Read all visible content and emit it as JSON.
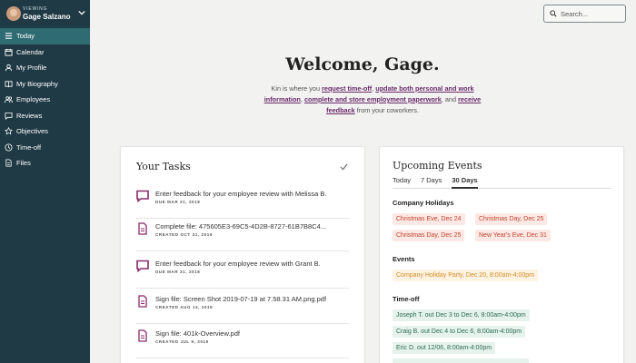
{
  "sidebar": {
    "viewing_label": "VIEWING",
    "user_name": "Gage Salzano",
    "items": [
      {
        "label": "Today",
        "icon": "list-icon",
        "active": true
      },
      {
        "label": "Calendar",
        "icon": "calendar-icon"
      },
      {
        "label": "My Profile",
        "icon": "person-icon"
      },
      {
        "label": "My Biography",
        "icon": "book-icon"
      },
      {
        "label": "Employees",
        "icon": "people-icon"
      },
      {
        "label": "Reviews",
        "icon": "chat-icon"
      },
      {
        "label": "Objectives",
        "icon": "star-icon"
      },
      {
        "label": "Time-off",
        "icon": "clock-icon"
      },
      {
        "label": "Files",
        "icon": "file-icon"
      }
    ]
  },
  "search": {
    "placeholder": "Search..."
  },
  "welcome": {
    "title": "Welcome, Gage.",
    "intro_1": "Kin is where you ",
    "link_1": "request time-off",
    "intro_2": ", ",
    "link_2": "update both personal and work information",
    "intro_3": ", ",
    "link_3": "complete and store employment paperwork",
    "intro_4": ", and ",
    "link_4": "receive feedback",
    "intro_5": " from your coworkers."
  },
  "tasks": {
    "title": "Your Tasks",
    "items": [
      {
        "title": "Enter feedback for your employee review with Melissa B.",
        "date": "DUE MAR 31, 2018",
        "icon": "feedback-icon"
      },
      {
        "title": "Complete file: 475605E3-69C5-4D2B-8727-61B7B8C4...",
        "date": "CREATED OCT 31, 2019",
        "icon": "document-icon"
      },
      {
        "title": "Enter feedback for your employee review with Grant B.",
        "date": "DUE MAR 31, 2018",
        "icon": "feedback-icon"
      },
      {
        "title": "Sign file: Screen Shot 2019-07-19 at 7.58.31 AM.png.pdf",
        "date": "CREATED AUG 13, 2019",
        "icon": "document-icon"
      },
      {
        "title": "Sign file: 401k-Overview.pdf",
        "date": "CREATED JUL 9, 2019",
        "icon": "document-icon"
      }
    ]
  },
  "events": {
    "title": "Upcoming Events",
    "tabs": [
      "Today",
      "7 Days",
      "30 Days"
    ],
    "active_tab": "30 Days",
    "holidays_title": "Company Holidays",
    "holidays": [
      "Christmas Eve, Dec 24",
      "Christmas Day, Dec 25",
      "Christmas Day, Dec 25",
      "New Year's Eve, Dec 31"
    ],
    "events_title": "Events",
    "events": [
      "Company Holiday Party, Dec 20, 8:00am-4:00pm"
    ],
    "timeoff_title": "Time-off",
    "timeoff": [
      "Joseph T. out Dec 3 to Dec 6, 8:00am-4:00pm",
      "Craig B. out Dec 4 to Dec 6, 8:00am-4:00pm",
      "Eric D. out 12/06, 8:00am-4:00pm"
    ]
  },
  "colors": {
    "sidebar": "#1f3a45",
    "active_nav": "#2f6b73",
    "link": "#6a2a6a",
    "feedback_icon": "#8a2a6b"
  }
}
